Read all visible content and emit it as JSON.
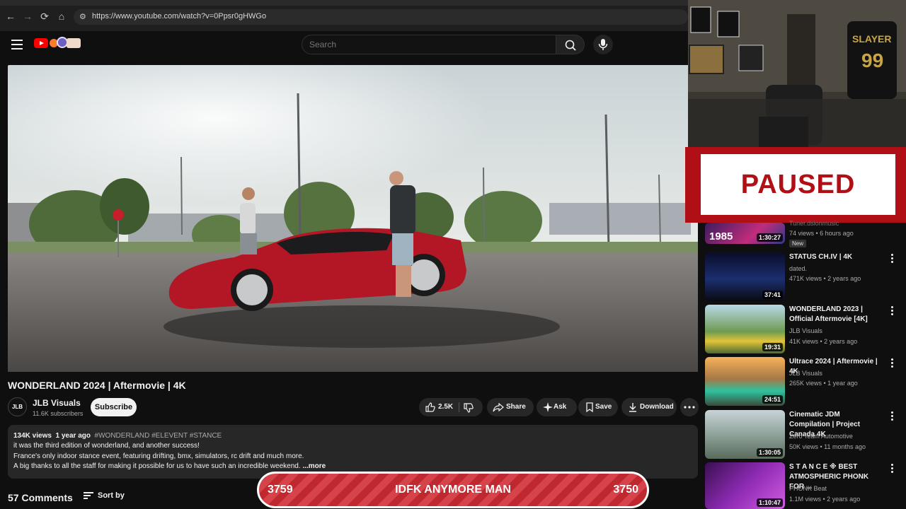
{
  "browser": {
    "url": "https://www.youtube.com/watch?v=0Ppsr0gHWGo"
  },
  "header": {
    "search_placeholder": "Search"
  },
  "video": {
    "title": "WONDERLAND 2024 | Aftermovie | 4K",
    "channel": "JLB Visuals",
    "channel_avatar_text": "JLB",
    "subscribers": "11.6K subscribers",
    "subscribe_label": "Subscribe",
    "likes": "2.5K",
    "share_label": "Share",
    "ask_label": "Ask",
    "save_label": "Save",
    "download_label": "Download"
  },
  "description": {
    "views": "134K views",
    "age": "1 year ago",
    "tags": "#WONDERLAND #ELEVENT #STANCE",
    "line1": "it was the third edition of wonderland, and another success!",
    "line2": "France's only indoor stance event, featuring drifting, bmx, simulators, rc drift and much more.",
    "line3": "A big thanks to all the staff for making it possible for us to have such an incredible weekend.",
    "more": "...more"
  },
  "comments": {
    "count_label": "57 Comments",
    "sort_label": "Sort by"
  },
  "overlay": {
    "paused_text": "PAUSED",
    "counter_left": "3759",
    "counter_text": "IDFK ANYMORE MAN",
    "counter_right": "3750"
  },
  "related": [
    {
      "title": "",
      "channel": "Tuner.dsionmusic",
      "views": "74 views • 6 hours ago",
      "duration": "1:30:27",
      "badge": "New",
      "thumb_text": "1985"
    },
    {
      "title": "STATUS CH.IV | 4K",
      "channel": "dated.",
      "views": "471K views • 2 years ago",
      "duration": "37:41"
    },
    {
      "title": "WONDERLAND 2023 | Official Aftermovie [4K]",
      "channel": "JLB Visuals",
      "views": "41K views • 2 years ago",
      "duration": "19:31"
    },
    {
      "title": "Ultrace 2024 | Aftermovie | 4K",
      "channel": "JLB Visuals",
      "views": "265K views • 1 year ago",
      "duration": "24:51"
    },
    {
      "title": "Cinematic JDM Compilation | Project Canada 4K",
      "channel": "Zero Team Automotive",
      "views": "50K views • 11 months ago",
      "duration": "1:30:05"
    },
    {
      "title": "S T A N C E ※ BEST ATMOSPHERIC PHONK FOR ...",
      "channel": "PHONK Beat",
      "views": "1.1M views • 2 years ago",
      "duration": "1:10:47"
    }
  ],
  "colors": {
    "youtube_red": "#ff0000",
    "paused_red": "#b00f16",
    "banner_red": "#c0282f",
    "background": "#0f0f0f"
  }
}
